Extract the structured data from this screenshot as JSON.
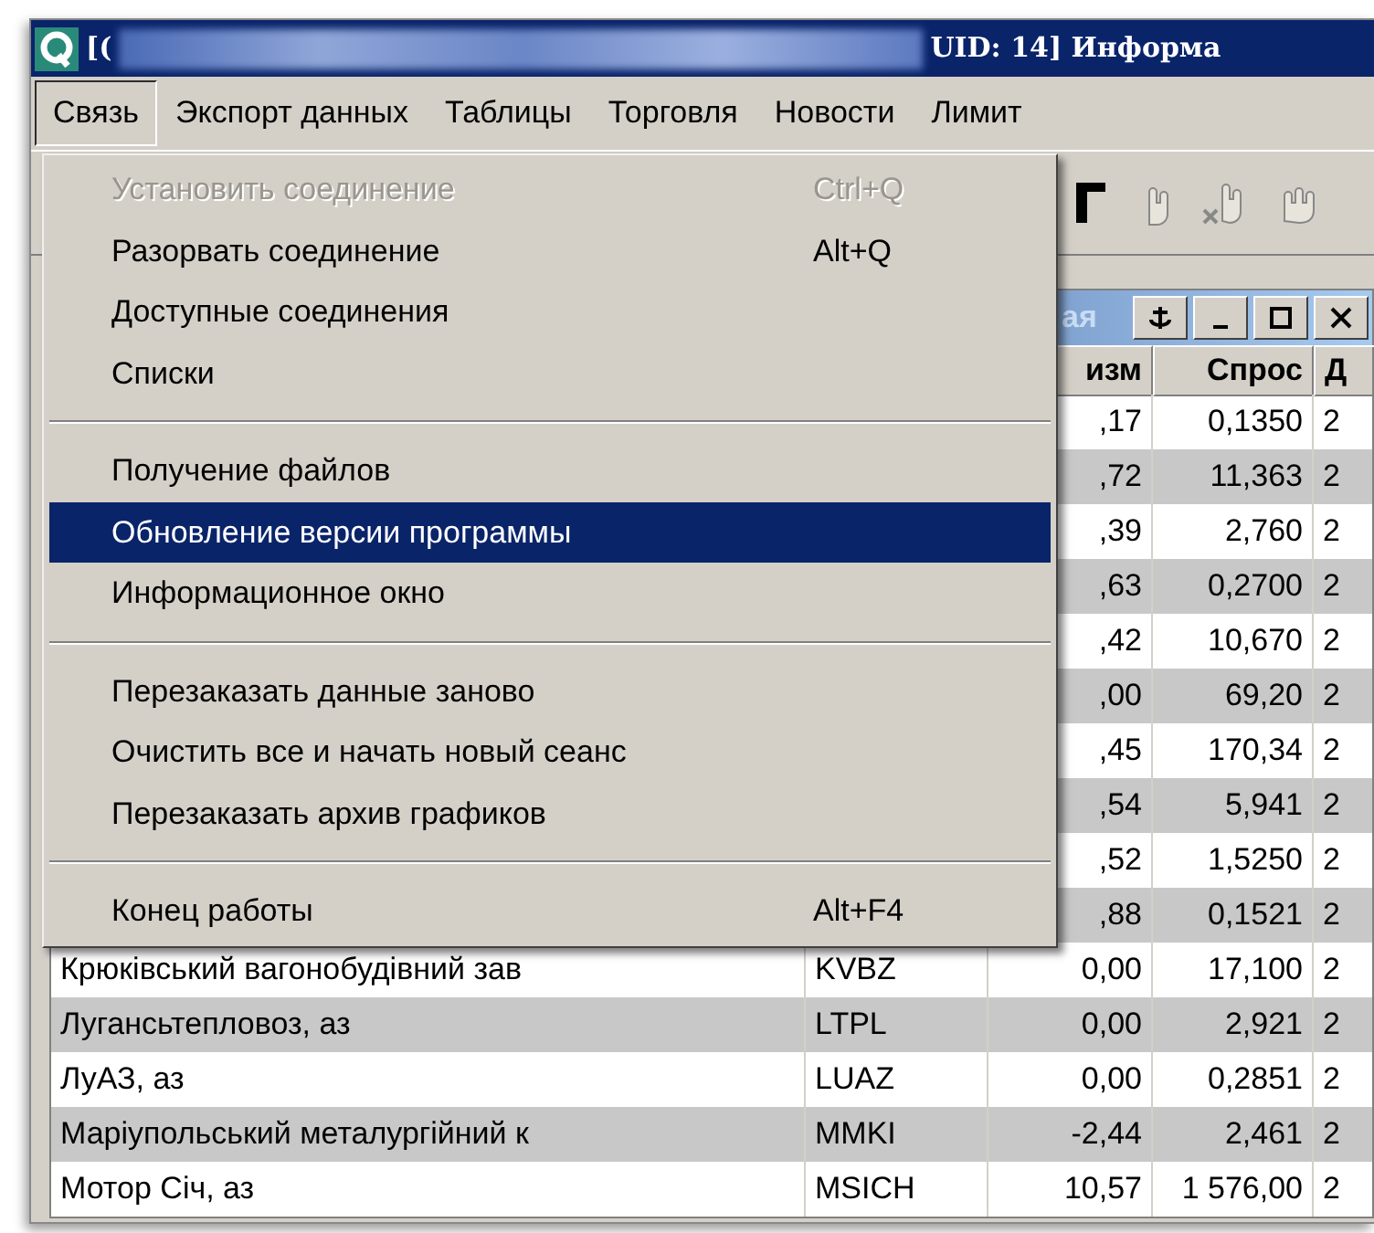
{
  "window": {
    "title_left": "[(",
    "title_right": "UID: 14] Информа"
  },
  "menu_bar": [
    {
      "label": "Связь",
      "selected": true
    },
    {
      "label": "Экспорт данных",
      "selected": false
    },
    {
      "label": "Таблицы",
      "selected": false
    },
    {
      "label": "Торговля",
      "selected": false
    },
    {
      "label": "Новости",
      "selected": false
    },
    {
      "label": "Лимит",
      "selected": false
    }
  ],
  "inner_window": {
    "title": "ая"
  },
  "table": {
    "columns": [
      "изм",
      "Спрос",
      "Д"
    ],
    "rows": [
      {
        "name": "",
        "code": "",
        "change": ",17",
        "bid": "0,1350",
        "column_5": "2"
      },
      {
        "name": "",
        "code": "",
        "change": ",72",
        "bid": "11,363",
        "column_5": "2"
      },
      {
        "name": "",
        "code": "",
        "change": ",39",
        "bid": "2,760",
        "column_5": "2"
      },
      {
        "name": "",
        "code": "",
        "change": ",63",
        "bid": "0,2700",
        "column_5": "2"
      },
      {
        "name": "",
        "code": "",
        "change": ",42",
        "bid": "10,670",
        "column_5": "2"
      },
      {
        "name": "",
        "code": "",
        "change": ",00",
        "bid": "69,20",
        "column_5": "2"
      },
      {
        "name": "",
        "code": "",
        "change": ",45",
        "bid": "170,34",
        "column_5": "2"
      },
      {
        "name": "",
        "code": "",
        "change": ",54",
        "bid": "5,941",
        "column_5": "2"
      },
      {
        "name": "",
        "code": "",
        "change": ",52",
        "bid": "1,5250",
        "column_5": "2"
      },
      {
        "name": "",
        "code": "",
        "change": ",88",
        "bid": "0,1521",
        "column_5": "2"
      },
      {
        "name": "Крюківський вагонобудівний зав",
        "code": "KVBZ",
        "change": "0,00",
        "bid": "17,100",
        "column_5": "2"
      },
      {
        "name": "Лугансьтепловоз, аз",
        "code": "LTPL",
        "change": "0,00",
        "bid": "2,921",
        "column_5": "2"
      },
      {
        "name": "ЛуАЗ, аз",
        "code": "LUAZ",
        "change": "0,00",
        "bid": "0,2851",
        "column_5": "2"
      },
      {
        "name": "Маріупольський металургійний к",
        "code": "MMKI",
        "change": "-2,44",
        "bid": "2,461",
        "column_5": "2"
      },
      {
        "name": "Мотор Січ, аз",
        "code": "MSICH",
        "change": "10,57",
        "bid": "1 576,00",
        "column_5": "2"
      }
    ]
  },
  "menu": {
    "items": [
      {
        "kind": "item",
        "label": "Установить соединение",
        "shortcut": "Ctrl+Q",
        "disabled": true,
        "selected": false
      },
      {
        "kind": "item",
        "label": "Разорвать соединение",
        "shortcut": "Alt+Q",
        "disabled": false,
        "selected": false
      },
      {
        "kind": "item",
        "label": "Доступные соединения",
        "disabled": false,
        "selected": false
      },
      {
        "kind": "item",
        "label": "Списки",
        "disabled": false,
        "selected": false
      },
      {
        "kind": "separator"
      },
      {
        "kind": "item",
        "label": "Получение файлов",
        "disabled": false,
        "selected": false
      },
      {
        "kind": "item",
        "label": "Обновление версии программы",
        "disabled": false,
        "selected": true
      },
      {
        "kind": "item",
        "label": "Информационное окно",
        "disabled": false,
        "selected": false
      },
      {
        "kind": "separator"
      },
      {
        "kind": "item",
        "label": "Перезаказать данные заново",
        "disabled": false,
        "selected": false
      },
      {
        "kind": "item",
        "label": "Очистить все и начать новый сеанс",
        "disabled": false,
        "selected": false
      },
      {
        "kind": "item",
        "label": "Перезаказать архив графиков",
        "disabled": false,
        "selected": false
      },
      {
        "kind": "separator"
      },
      {
        "kind": "item",
        "label": "Конец работы",
        "shortcut": "Alt+F4",
        "disabled": false,
        "selected": false
      }
    ]
  }
}
